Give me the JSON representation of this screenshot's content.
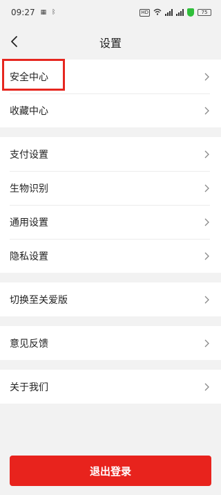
{
  "status_bar": {
    "time": "09:27",
    "icons": [
      "notification-icon",
      "bluetooth-icon"
    ],
    "hd_label": "HD",
    "battery": "75"
  },
  "nav": {
    "title": "设置",
    "back_icon": "chevron-left-icon"
  },
  "groups": [
    {
      "items": [
        {
          "label": "安全中心"
        },
        {
          "label": "收藏中心"
        }
      ]
    },
    {
      "items": [
        {
          "label": "支付设置"
        },
        {
          "label": "生物识别"
        },
        {
          "label": "通用设置"
        },
        {
          "label": "隐私设置"
        }
      ]
    },
    {
      "items": [
        {
          "label": "切换至关爱版"
        }
      ]
    },
    {
      "items": [
        {
          "label": "意见反馈"
        }
      ]
    },
    {
      "items": [
        {
          "label": "关于我们"
        }
      ]
    }
  ],
  "logout": {
    "label": "退出登录"
  },
  "colors": {
    "accent": "#e8231d",
    "highlight": "#e6261f",
    "background": "#f2f2f2"
  }
}
